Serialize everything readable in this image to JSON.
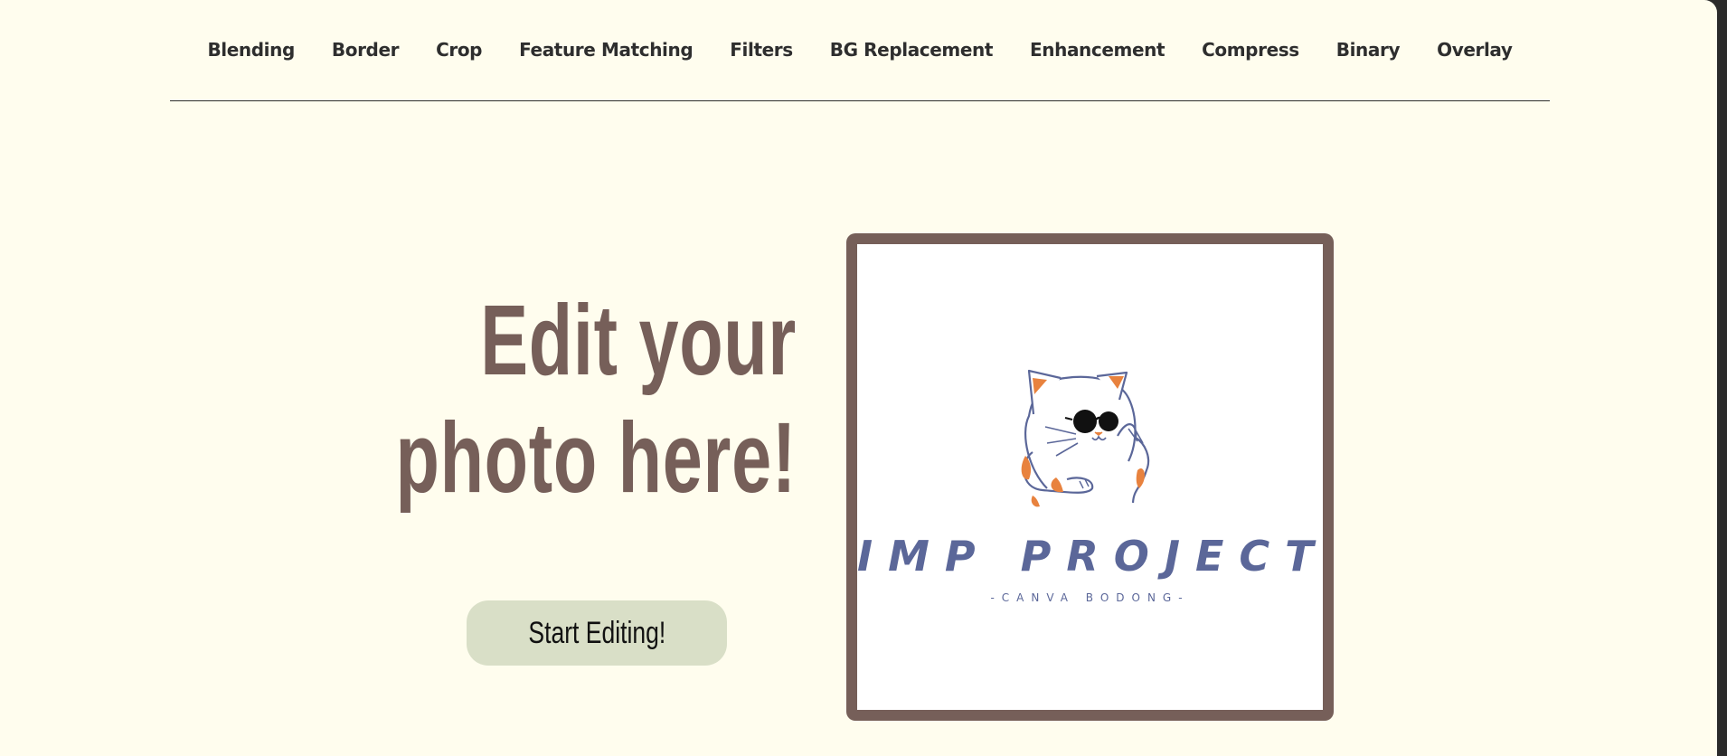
{
  "nav": {
    "items": [
      {
        "label": "Blending"
      },
      {
        "label": "Border"
      },
      {
        "label": "Crop"
      },
      {
        "label": "Feature Matching"
      },
      {
        "label": "Filters"
      },
      {
        "label": "BG Replacement"
      },
      {
        "label": "Enhancement"
      },
      {
        "label": "Compress"
      },
      {
        "label": "Binary"
      },
      {
        "label": "Overlay"
      }
    ]
  },
  "hero": {
    "headline_line1": "Edit your",
    "headline_line2": "photo here!",
    "cta_label": "Start Editing!"
  },
  "logo": {
    "title": "IMP PROJECT",
    "subtitle": "-CANVA BODONG-",
    "icon": "cat-with-sunglasses-icon"
  },
  "colors": {
    "background": "#fffdee",
    "headline": "#765f59",
    "frame": "#765f59",
    "button": "#d9dfc7",
    "logo_text": "#5b6799",
    "cat_patch": "#e8823e"
  }
}
